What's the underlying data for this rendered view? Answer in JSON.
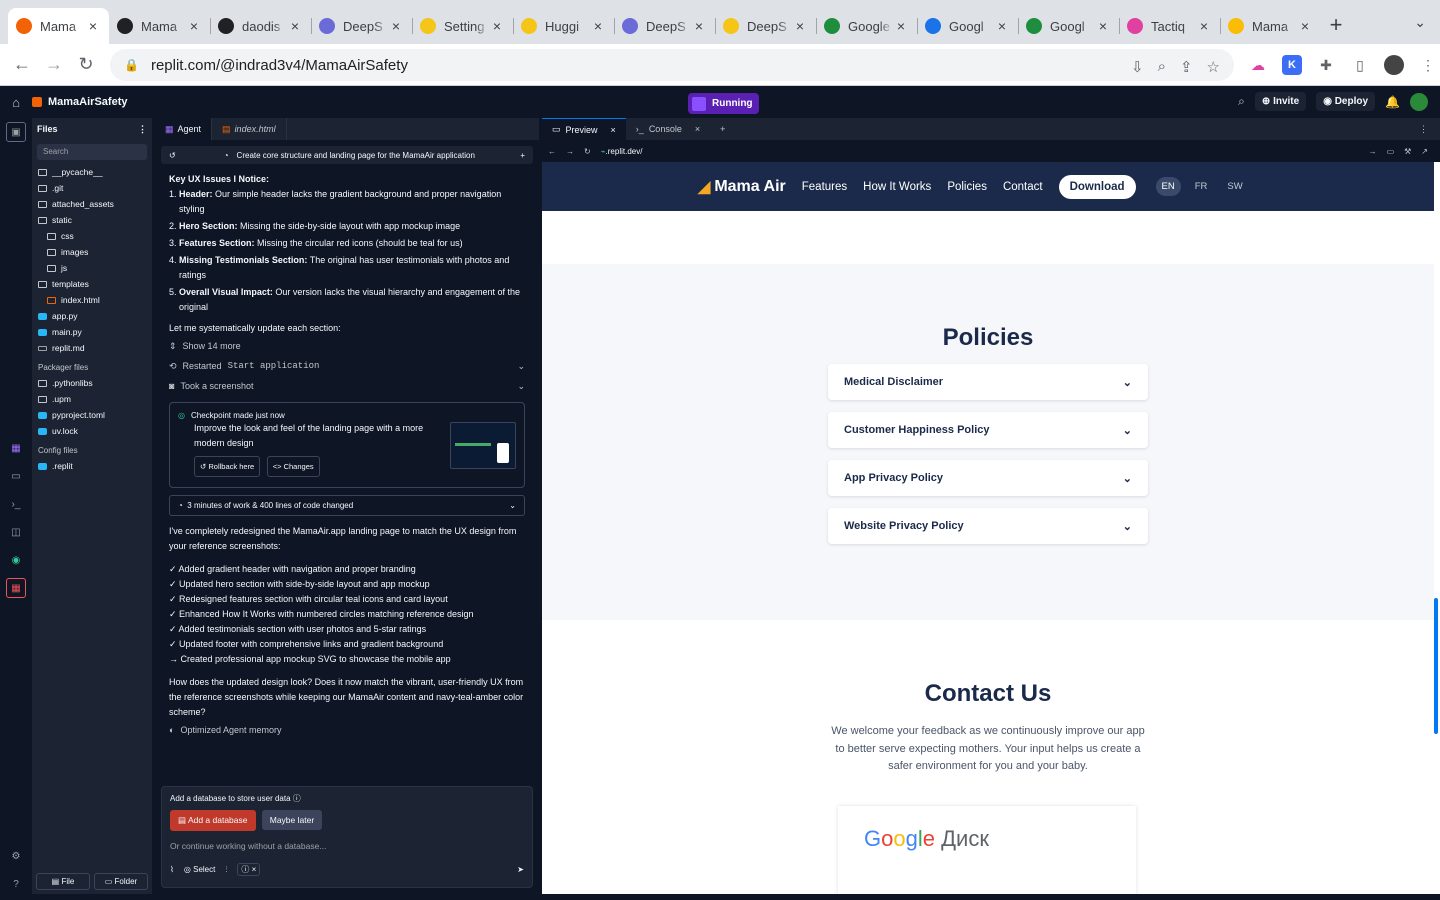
{
  "browser": {
    "tabs": [
      {
        "title": "Mama",
        "icon": "replit-icon",
        "active": true
      },
      {
        "title": "Mama",
        "icon": "openai-icon"
      },
      {
        "title": "daodis",
        "icon": "openai-icon"
      },
      {
        "title": "DeepS",
        "icon": "deepseek-icon"
      },
      {
        "title": "Setting",
        "icon": "huggingface-icon"
      },
      {
        "title": "Huggi",
        "icon": "huggingface-icon"
      },
      {
        "title": "DeepS",
        "icon": "deepseek-icon"
      },
      {
        "title": "DeepS",
        "icon": "huggingface-icon"
      },
      {
        "title": "Google",
        "icon": "google-meet-icon"
      },
      {
        "title": "Googl",
        "icon": "google-calendar-icon"
      },
      {
        "title": "Googl",
        "icon": "google-meet-icon"
      },
      {
        "title": "Tactiq",
        "icon": "tactiq-icon"
      },
      {
        "title": "Mama",
        "icon": "google-drive-icon"
      }
    ],
    "url": "replit.com/@indrad3v4/MamaAirSafety"
  },
  "replit": {
    "project_name": "MamaAirSafety",
    "run_label": "Running",
    "invite_label": "Invite",
    "deploy_label": "Deploy"
  },
  "files": {
    "header": "Files",
    "search_placeholder": "Search",
    "tree": [
      {
        "name": "__pycache__",
        "type": "folder",
        "indent": 0
      },
      {
        "name": ".git",
        "type": "folder",
        "indent": 0
      },
      {
        "name": "attached_assets",
        "type": "folder",
        "indent": 0
      },
      {
        "name": "static",
        "type": "folder",
        "indent": 0
      },
      {
        "name": "css",
        "type": "folder",
        "indent": 1
      },
      {
        "name": "images",
        "type": "folder",
        "indent": 1
      },
      {
        "name": "js",
        "type": "folder",
        "indent": 1
      },
      {
        "name": "templates",
        "type": "folder",
        "indent": 0
      },
      {
        "name": "index.html",
        "type": "html",
        "indent": 1
      },
      {
        "name": "app.py",
        "type": "py",
        "indent": 0
      },
      {
        "name": "main.py",
        "type": "py",
        "indent": 0
      },
      {
        "name": "replit.md",
        "type": "md",
        "indent": 0
      }
    ],
    "packager_header": "Packager files",
    "packager": [
      {
        "name": ".pythonlibs",
        "type": "folder"
      },
      {
        "name": ".upm",
        "type": "folder"
      },
      {
        "name": "pyproject.toml",
        "type": "py"
      },
      {
        "name": "uv.lock",
        "type": "py"
      }
    ],
    "config_header": "Config files",
    "config": [
      {
        "name": ".replit",
        "type": "py"
      }
    ],
    "file_btn": "File",
    "folder_btn": "Folder"
  },
  "agent": {
    "tab_agent": "Agent",
    "tab_file": "index.html",
    "crumb": "Create core structure and landing page for the MamaAir application",
    "issues_title": "Key UX Issues I Notice:",
    "issues": [
      {
        "n": "1.",
        "b": "Header:",
        "t": " Our simple header lacks the gradient background and proper navigation styling"
      },
      {
        "n": "2.",
        "b": "Hero Section:",
        "t": " Missing the side-by-side layout with app mockup image"
      },
      {
        "n": "3.",
        "b": "Features Section:",
        "t": " Missing the circular red icons (should be teal for us)"
      },
      {
        "n": "4.",
        "b": "Missing Testimonials Section:",
        "t": " The original has user testimonials with photos and ratings"
      },
      {
        "n": "5.",
        "b": "Overall Visual Impact:",
        "t": " Our version lacks the visual hierarchy and engagement of the original"
      }
    ],
    "plan": "Let me systematically update each section:",
    "show_more": "Show 14 more",
    "restarted": "Restarted",
    "restarted_code": "Start application",
    "screenshot": "Took a screenshot",
    "checkpoint_title": "Checkpoint made just now",
    "checkpoint_desc": "Improve the look and feel of the landing page with a more modern design",
    "rollback": "Rollback here",
    "changes": "Changes",
    "work_summary": "3 minutes of work & 400 lines of code changed",
    "summary_intro": "I've completely redesigned the MamaAir.app landing page to match the UX design from your reference screenshots:",
    "checks": [
      "✓ Added gradient header with navigation and proper branding",
      "✓ Updated hero section with side-by-side layout and app mockup",
      "✓ Redesigned features section with circular teal icons and card layout",
      "✓ Enhanced How It Works with numbered circles matching reference design",
      "✓ Added testimonials section with user photos and 5-star ratings",
      "✓ Updated footer with comprehensive links and gradient background",
      "→ Created professional app mockup SVG to showcase the mobile app"
    ],
    "question": "How does the updated design look? Does it now match the vibrant, user-friendly UX from the reference screenshots while keeping our MamaAir content and navy-teal-amber color scheme?",
    "memory": "Optimized Agent memory",
    "db_prompt": "Add a database to store user data",
    "db_add": "Add a database",
    "db_later": "Maybe later",
    "input_placeholder": "Or continue working without a database...",
    "select_label": "Select"
  },
  "preview": {
    "tab_preview": "Preview",
    "tab_console": "Console",
    "url": ".replit.dev/",
    "site": {
      "brand": "Mama Air",
      "nav": [
        "Features",
        "How It Works",
        "Policies",
        "Contact"
      ],
      "download": "Download",
      "langs": [
        "EN",
        "FR",
        "SW"
      ],
      "policies_title": "Policies",
      "policies": [
        "Medical Disclaimer",
        "Customer Happiness Policy",
        "App Privacy Policy",
        "Website Privacy Policy"
      ],
      "contact_title": "Contact Us",
      "contact_text": "We welcome your feedback as we continuously improve our app to better serve expecting mothers. Your input helps us create a safer environment for you and your baby.",
      "google_text": "Google",
      "disk_text": "Диск"
    }
  },
  "colors": {
    "replit_bg": "#0e1525",
    "panel": "#1c2333",
    "accent_purple": "#5a1fb3",
    "site_navy": "#1b2a4a",
    "db_red": "#c0392b"
  }
}
